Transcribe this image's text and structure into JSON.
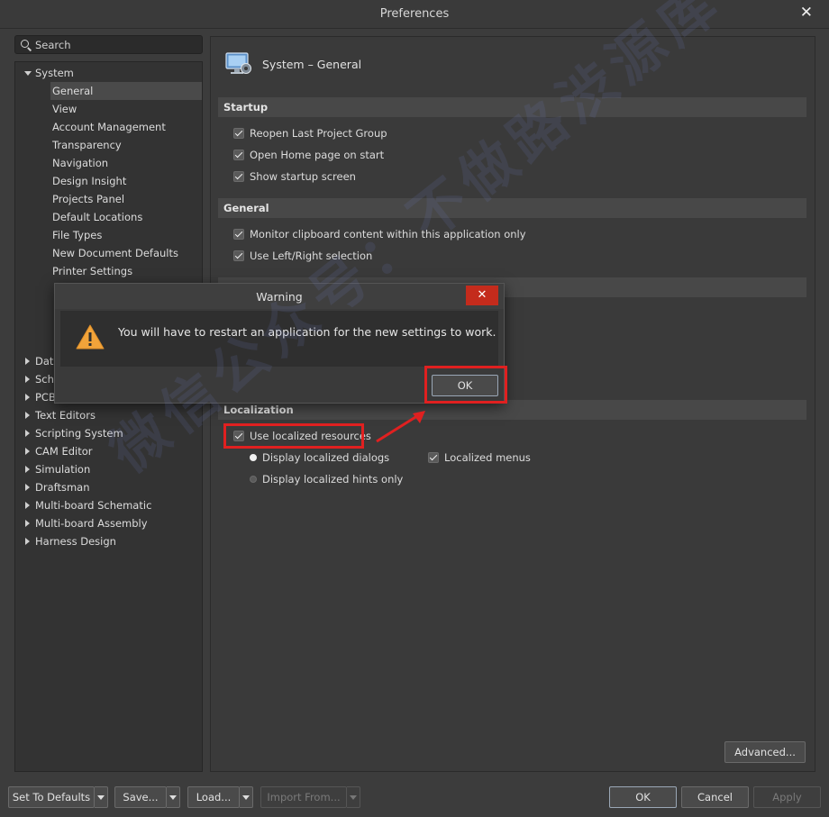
{
  "window": {
    "title": "Preferences",
    "close_glyph": "✕"
  },
  "search": {
    "placeholder": "Search"
  },
  "tree": {
    "system_label": "System",
    "system_children": [
      "General",
      "View",
      "Account Management",
      "Transparency",
      "Navigation",
      "Design Insight",
      "Projects Panel",
      "Default Locations",
      "File Types",
      "New Document Defaults",
      "Printer Settings"
    ],
    "selected": "General",
    "collapsed_items": [
      "Data",
      "Scho",
      "PCB",
      "Text Editors",
      "Scripting System",
      "CAM Editor",
      "Simulation",
      "Draftsman",
      "Multi-board Schematic",
      "Multi-board Assembly",
      "Harness Design"
    ]
  },
  "page": {
    "title": "System – General",
    "icon": "monitor-gear-icon",
    "sections": {
      "startup": "Startup",
      "general": "General",
      "localization": "Localization"
    },
    "startup_options": [
      {
        "label": "Reopen Last Project Group",
        "checked": true
      },
      {
        "label": "Open Home page on start",
        "checked": true
      },
      {
        "label": "Show startup screen",
        "checked": true
      }
    ],
    "general_options": [
      {
        "label": "Monitor clipboard content within this application only",
        "checked": true
      },
      {
        "label": "Use Left/Right selection",
        "checked": true
      }
    ],
    "localization": {
      "use_localized": {
        "label": "Use localized resources",
        "checked": true
      },
      "display_dialogs": {
        "label": "Display localized dialogs",
        "selected": true
      },
      "display_hints": {
        "label": "Display localized hints only",
        "selected": false
      },
      "localized_menus": {
        "label": "Localized menus",
        "checked": true
      }
    },
    "advanced_button": "Advanced..."
  },
  "dialog": {
    "title": "Warning",
    "close_glyph": "✕",
    "message": "You will have to restart an application for the new settings to work.",
    "ok_label": "OK",
    "icon": "warning-triangle-icon"
  },
  "footer": {
    "set_defaults": "Set To Defaults",
    "save": "Save...",
    "load": "Load...",
    "import_from": "Import From...",
    "ok": "OK",
    "cancel": "Cancel",
    "apply": "Apply"
  },
  "watermark": "微信公众号：不做路渋源库",
  "colors": {
    "background": "#3c3c3c",
    "panel": "#3a3a3a",
    "tree": "#333333",
    "section_header": "#484848",
    "dialog_close": "#c42b1c",
    "highlight": "#e02020",
    "warning": "#f2a43a"
  }
}
